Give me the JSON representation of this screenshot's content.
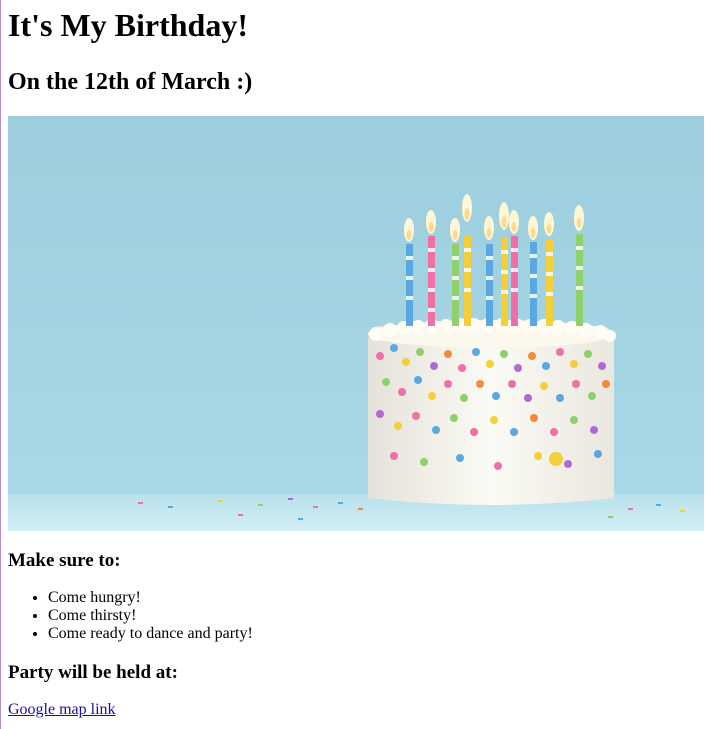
{
  "title": "It's My Birthday!",
  "subtitle": "On the 12th of March :)",
  "image": {
    "description": "birthday cake with candles and sprinkles"
  },
  "make_sure": {
    "heading": "Make sure to:",
    "items": [
      "Come hungry!",
      "Come thirsty!",
      "Come ready to dance and party!"
    ]
  },
  "location": {
    "heading": "Party will be held at:",
    "link_text": "Google map link"
  },
  "colors": {
    "background": "#ffffff",
    "link": "#1a0dab",
    "sky": "#9fd1de"
  }
}
